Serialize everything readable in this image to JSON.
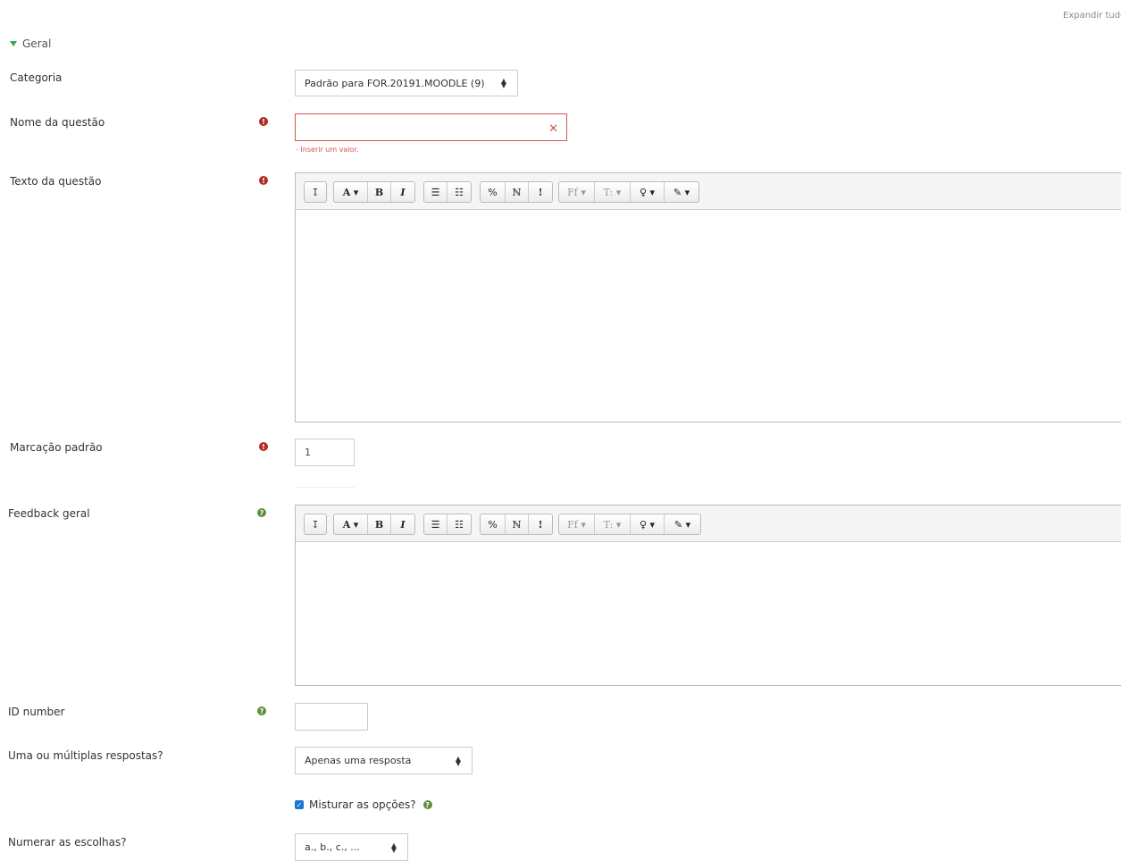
{
  "section": {
    "title": "Geral"
  },
  "top_right": {
    "label": "Expandir tudo"
  },
  "category": {
    "label": "Categoria",
    "value": "Padrão para FOR.20191.MOODLE (9)"
  },
  "question_name": {
    "label": "Nome da questão",
    "value": "",
    "error": "- Inserir um valor."
  },
  "question_text": {
    "label": "Texto da questão"
  },
  "default_mark": {
    "label": "Marcação padrão",
    "value": "1"
  },
  "general_feedback": {
    "label": "Feedback geral"
  },
  "id_number": {
    "label": "ID number",
    "value": ""
  },
  "single_multiple": {
    "label": "Uma ou múltiplas respostas?",
    "value": "Apenas uma resposta"
  },
  "shuffle": {
    "label": "Misturar as opções?",
    "checked": true
  },
  "numbering": {
    "label": "Numerar as escolhas?",
    "value": "a., b., c., ..."
  },
  "toolbar": {
    "show_more": "↧",
    "font_color": "A",
    "bold": "B",
    "italic": "I",
    "unordered_list": "☰",
    "ordered_list": "☷",
    "link": "%",
    "unlink": "ℕ",
    "warning": "!",
    "font_family": "Ff",
    "font_size": "T:",
    "bulb": "♀",
    "brush": "✎"
  },
  "icons": {
    "required": "exclamation-circle-icon",
    "help": "question-circle-icon",
    "clear": "x-icon"
  },
  "colors": {
    "error": "#d9534f",
    "required": "#b32a25",
    "help": "#5d8f3a",
    "checkbox": "#1976d2"
  }
}
